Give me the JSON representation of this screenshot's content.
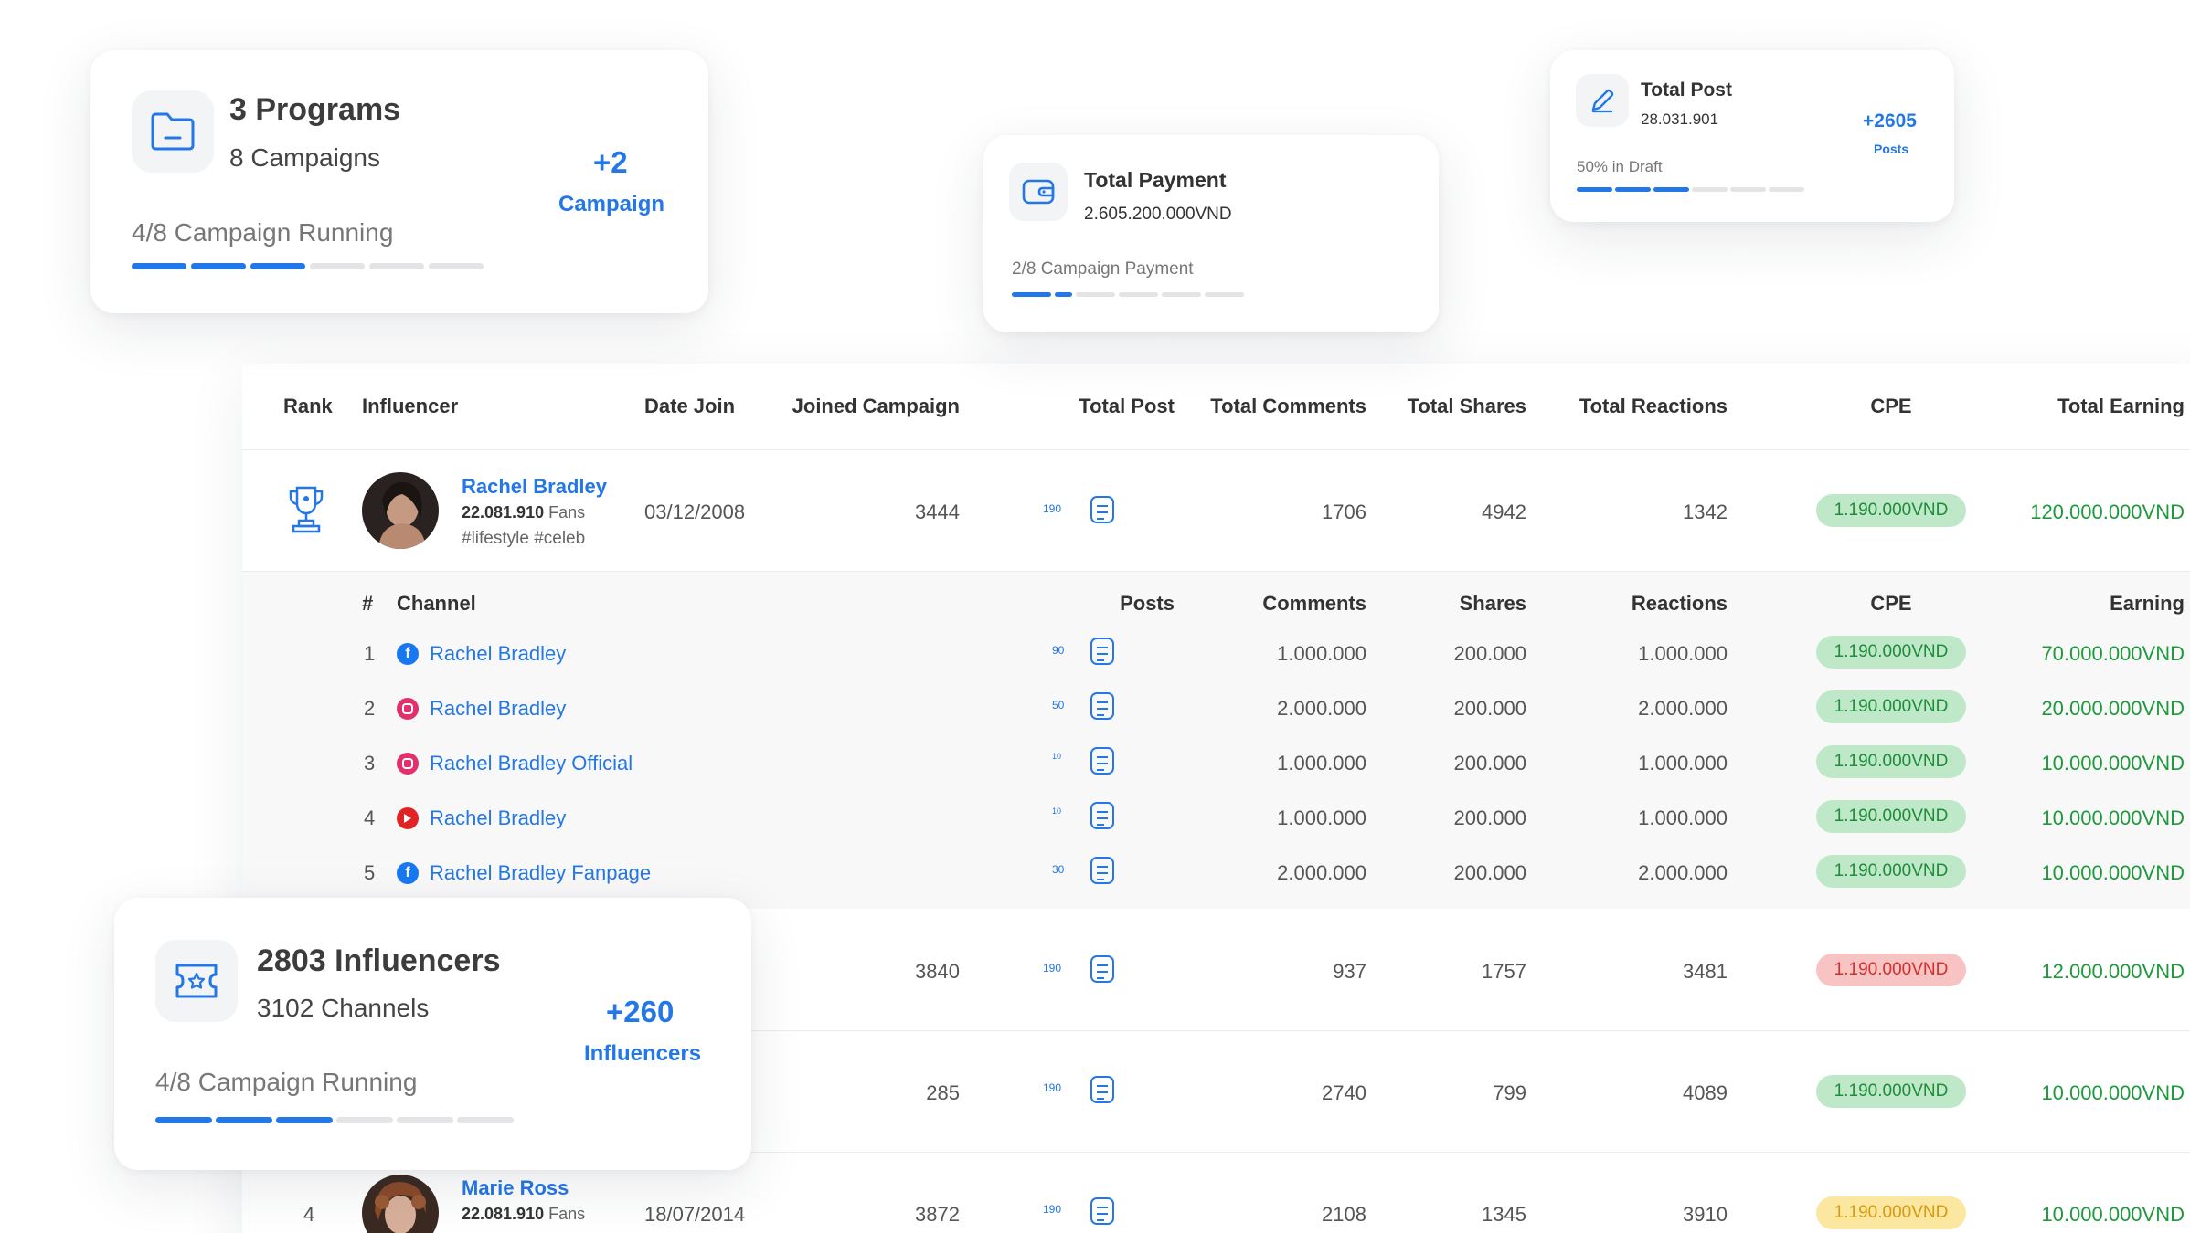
{
  "programs_card": {
    "title": "3 Programs",
    "subtitle": "8 Campaigns",
    "delta": "+2",
    "delta_label": "Campaign",
    "progress_label": "4/8 Campaign Running",
    "progress": {
      "done": 3,
      "total": 6
    },
    "icon": "folder-icon"
  },
  "payment_card": {
    "title": "Total Payment",
    "value": "2.605.200.000VND",
    "progress_label": "2/8 Campaign Payment",
    "progress": {
      "done": 2,
      "total": 8
    },
    "icon": "wallet-icon"
  },
  "post_card": {
    "title": "Total Post",
    "value": "28.031.901",
    "delta": "+2605",
    "delta_label": "Posts",
    "progress_label": "50% in Draft",
    "progress": {
      "done": 3,
      "total": 6
    },
    "icon": "pencil-icon"
  },
  "influencers_card": {
    "title": "2803 Influencers",
    "subtitle": "3102 Channels",
    "delta": "+260",
    "delta_label": "Influencers",
    "progress_label": "4/8 Campaign Running",
    "progress": {
      "done": 3,
      "total": 6
    },
    "icon": "star-ticket-icon"
  },
  "table": {
    "headers": {
      "rank": "Rank",
      "influencer": "Influencer",
      "date_join": "Date Join",
      "joined_campaign": "Joined Campaign",
      "total_post": "Total Post",
      "total_comments": "Total Comments",
      "total_shares": "Total Shares",
      "total_reactions": "Total Reactions",
      "cpe": "CPE",
      "total_earning": "Total Earning"
    },
    "rows": [
      {
        "rank_icon": "trophy-icon",
        "name": "Rachel Bradley",
        "fans": "22.081.910",
        "fans_label": "Fans",
        "tags": "#lifestyle  #celeb",
        "date_join": "03/12/2008",
        "joined_campaign": "3444",
        "post_count": "190",
        "comments": "1706",
        "shares": "4942",
        "reactions": "1342",
        "cpe": "1.190.000VND",
        "cpe_status": "green",
        "earning": "120.000.000VND"
      },
      {
        "joined_campaign": "3840",
        "post_count": "190",
        "comments": "937",
        "shares": "1757",
        "reactions": "3481",
        "cpe": "1.190.000VND",
        "cpe_status": "red",
        "earning": "12.000.000VND"
      },
      {
        "joined_campaign": "285",
        "post_count": "190",
        "comments": "2740",
        "shares": "799",
        "reactions": "4089",
        "cpe": "1.190.000VND",
        "cpe_status": "green",
        "earning": "10.000.000VND"
      },
      {
        "rank": "4",
        "name": "Marie Ross",
        "fans": "22.081.910",
        "fans_label": "Fans",
        "date_join": "18/07/2014",
        "joined_campaign": "3872",
        "post_count": "190",
        "comments": "2108",
        "shares": "1345",
        "reactions": "3910",
        "cpe": "1.190.000VND",
        "cpe_status": "yellow",
        "earning": "10.000.000VND"
      }
    ],
    "sub_headers": {
      "index": "#",
      "channel": "Channel",
      "posts": "Posts",
      "comments": "Comments",
      "shares": "Shares",
      "reactions": "Reactions",
      "cpe": "CPE",
      "earning": "Earning"
    },
    "channels": [
      {
        "index": "1",
        "platform": "facebook-icon",
        "name": "Rachel Bradley",
        "posts": "90",
        "comments": "1.000.000",
        "shares": "200.000",
        "reactions": "1.000.000",
        "cpe": "1.190.000VND",
        "earning": "70.000.000VND"
      },
      {
        "index": "2",
        "platform": "instagram-icon",
        "name": "Rachel Bradley",
        "posts": "50",
        "comments": "2.000.000",
        "shares": "200.000",
        "reactions": "2.000.000",
        "cpe": "1.190.000VND",
        "earning": "20.000.000VND"
      },
      {
        "index": "3",
        "platform": "instagram-icon",
        "name": "Rachel Bradley Official",
        "posts": "10",
        "comments": "1.000.000",
        "shares": "200.000",
        "reactions": "1.000.000",
        "cpe": "1.190.000VND",
        "earning": "10.000.000VND"
      },
      {
        "index": "4",
        "platform": "youtube-icon",
        "name": "Rachel Bradley",
        "posts": "10",
        "comments": "1.000.000",
        "shares": "200.000",
        "reactions": "1.000.000",
        "cpe": "1.190.000VND",
        "earning": "10.000.000VND"
      },
      {
        "index": "5",
        "platform": "facebook-icon",
        "name": "Rachel Bradley Fanpage",
        "posts": "30",
        "comments": "2.000.000",
        "shares": "200.000",
        "reactions": "2.000.000",
        "cpe": "1.190.000VND",
        "earning": "10.000.000VND"
      }
    ]
  },
  "colors": {
    "accent": "#2477e6",
    "earning": "#1e9a3c",
    "cpe_green_bg": "#bfe8c8",
    "cpe_red_bg": "#f7c3c3",
    "cpe_yellow_bg": "#fbe7a0"
  }
}
